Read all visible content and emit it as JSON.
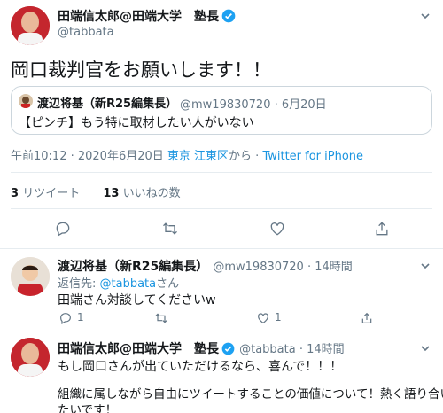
{
  "main_tweet": {
    "author_name": "田端信太郎@田端大学　塾長",
    "handle": "@tabbata",
    "text": "岡口裁判官をお願いします！！",
    "quoted": {
      "author_name": "渡辺将基（新R25編集長）",
      "handle_date": "@mw19830720 · 6月20日",
      "text": "【ピンチ】もう特に取材したい人がいない"
    },
    "meta_time": "午前10:12 · 2020年6月20日",
    "location": "東京 江東区",
    "from_text": "から · ",
    "source": "Twitter for iPhone",
    "retweet_count": "3",
    "retweet_label": "リツイート",
    "like_count": "13",
    "like_label": "いいねの数"
  },
  "reply1": {
    "author_name": "渡辺将基（新R25編集長）",
    "handle_time": "@mw19830720 · 14時間",
    "reply_prefix": "返信先: ",
    "reply_handle": "@tabbata",
    "reply_suffix": "さん",
    "text": "田端さん対談してくださいw",
    "reply_count": "1",
    "like_count": "1"
  },
  "reply2": {
    "author_name": "田端信太郎@田端大学　塾長",
    "handle_time": "@tabbata · 14時間",
    "line1": "もし岡口さんが出ていただけるなら、喜んで！！！",
    "line2": "組織に属しながら自由にツイートすることの価値について！熱く語り合い",
    "line3": "たいです！"
  },
  "icons": [
    "verified-icon",
    "chevron-down-icon",
    "reply-icon",
    "retweet-icon",
    "like-icon",
    "share-icon"
  ],
  "colors": {
    "accent": "#1da1f2",
    "link": "#1b95e0",
    "text": "#14171a",
    "secondary": "#657786",
    "border": "#e6ecf0"
  }
}
